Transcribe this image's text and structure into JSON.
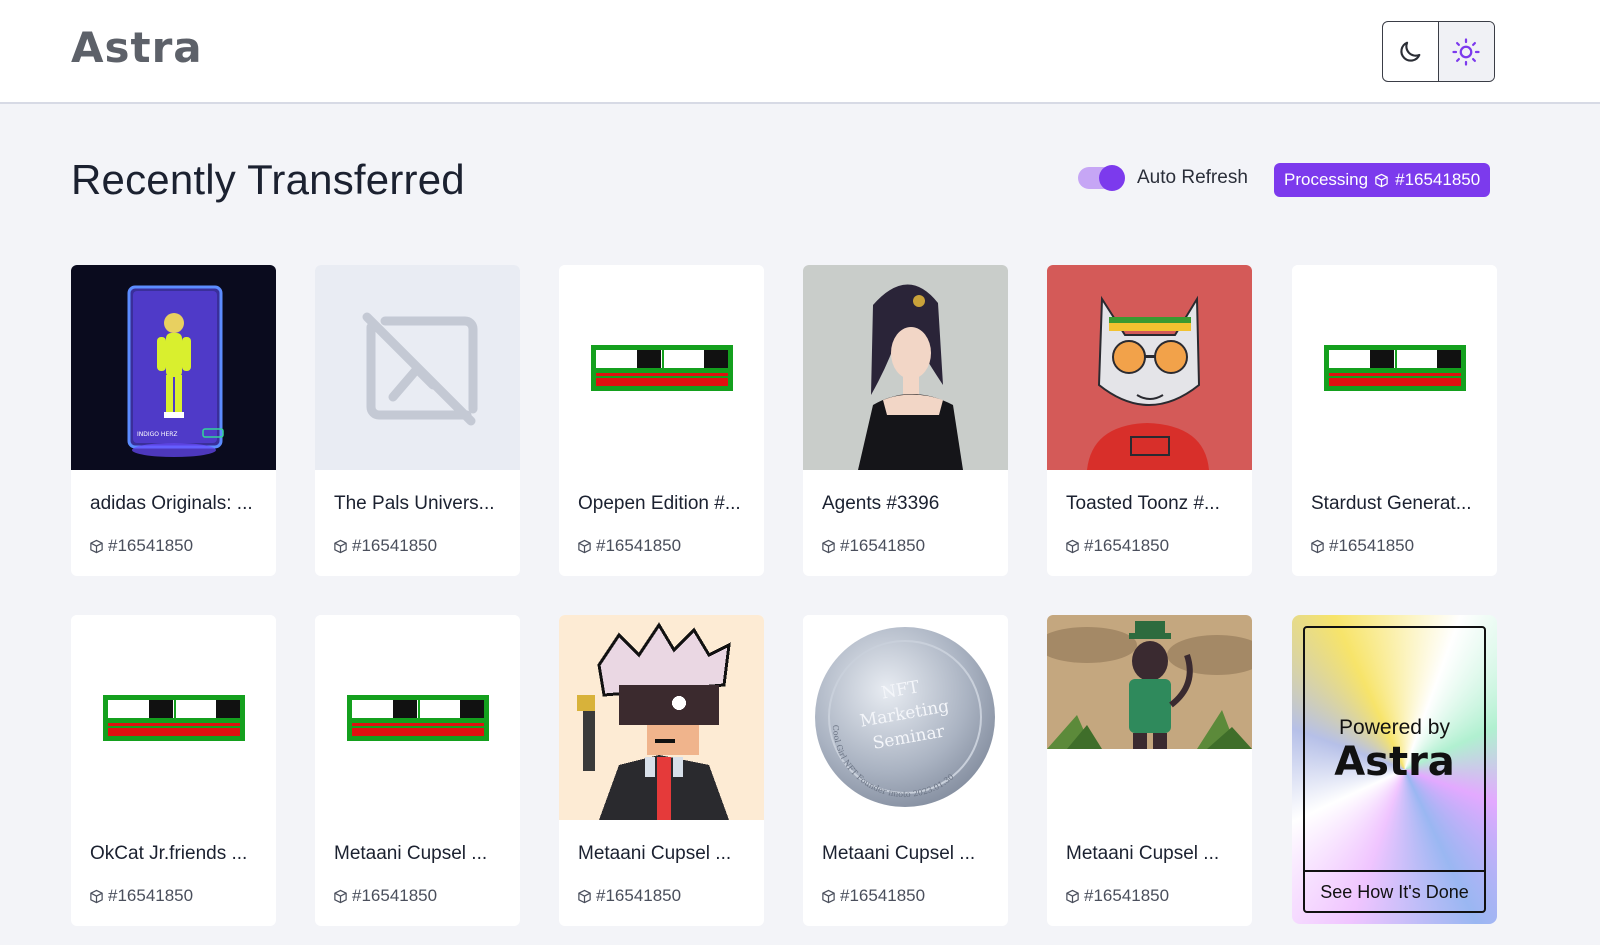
{
  "header": {
    "logo": "Astra",
    "theme": {
      "dark_icon": "moon-icon",
      "light_icon": "sun-icon",
      "active": "light"
    }
  },
  "section": {
    "title": "Recently Transferred",
    "auto_refresh_label": "Auto Refresh",
    "auto_refresh_on": true,
    "processing_label": "Processing",
    "processing_block": "#16541850"
  },
  "cards": [
    {
      "name": "adidas Originals: ...",
      "block": "#16541850",
      "thumb": "adidas"
    },
    {
      "name": "The Pals Univers...",
      "block": "#16541850",
      "thumb": "no-image"
    },
    {
      "name": "Opepen Edition #...",
      "block": "#16541850",
      "thumb": "bar"
    },
    {
      "name": "Agents #3396",
      "block": "#16541850",
      "thumb": "agent"
    },
    {
      "name": "Toasted Toonz #...",
      "block": "#16541850",
      "thumb": "cat"
    },
    {
      "name": "Stardust Generat...",
      "block": "#16541850",
      "thumb": "bar"
    },
    {
      "name": "OkCat Jr.friends ...",
      "block": "#16541850",
      "thumb": "bar"
    },
    {
      "name": "Metaani Cupsel ...",
      "block": "#16541850",
      "thumb": "bar"
    },
    {
      "name": "Metaani Cupsel ...",
      "block": "#16541850",
      "thumb": "pixel"
    },
    {
      "name": "Metaani Cupsel ...",
      "block": "#16541850",
      "thumb": "coin"
    },
    {
      "name": "Metaani Cupsel ...",
      "block": "#16541850",
      "thumb": "jungle"
    }
  ],
  "promo": {
    "line1": "Powered by",
    "logo": "Astra",
    "cta": "See How It's Done"
  },
  "coin_text": {
    "line1": "NFT",
    "line2": "Marketing",
    "line3": "Seminar",
    "rim": "Cool Girl NFT Founder imoto 2023.01.30"
  },
  "colors": {
    "accent": "#7c3aed",
    "accent_light": "#c6a6f5",
    "page_bg": "#f3f4f8"
  }
}
